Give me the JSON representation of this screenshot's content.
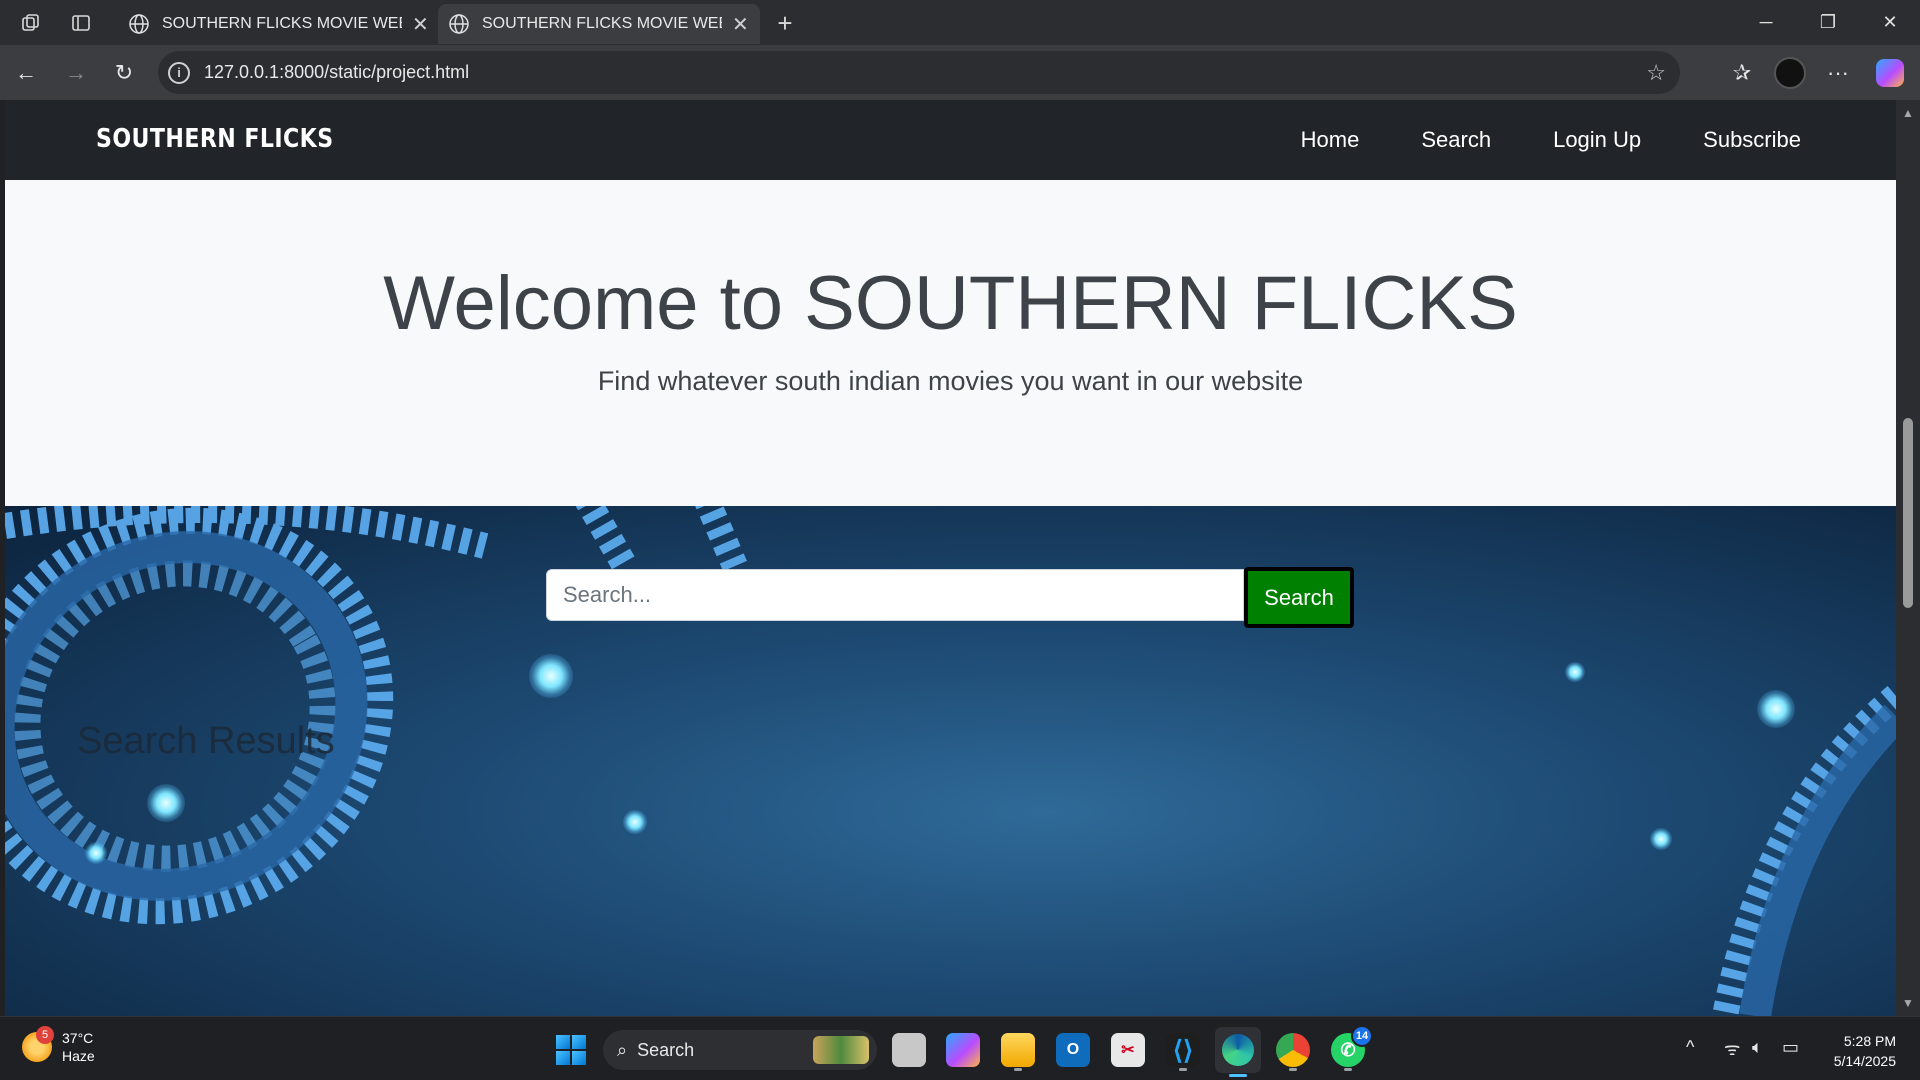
{
  "browser": {
    "tabs": [
      {
        "title": "SOUTHERN FLICKS MOVIE WEBSI",
        "active": false
      },
      {
        "title": "SOUTHERN FLICKS MOVIE WEBSI",
        "active": true
      }
    ],
    "new_tab_symbol": "+",
    "url": "127.0.0.1:8000/static/project.html"
  },
  "site": {
    "brand": "SOUTHERN FLICKS",
    "nav": [
      "Home",
      "Search",
      "Login Up",
      "Subscribe"
    ],
    "hero": {
      "title": "Welcome to SOUTHERN FLICKS",
      "subtitle": "Find whatever south indian movies you want in our website"
    },
    "search": {
      "placeholder": "Search...",
      "button_label": "Search"
    },
    "results_heading": "Search Results"
  },
  "taskbar": {
    "weather": {
      "temp": "37°C",
      "condition": "Haze",
      "badge": "5"
    },
    "search_label": "Search",
    "apps": [
      "task-view",
      "copilot",
      "file-explorer",
      "outlook",
      "snipping-tool",
      "vs-code",
      "edge",
      "chrome",
      "whatsapp"
    ],
    "whatsapp_badge": "14",
    "time": "5:28 PM",
    "date": "5/14/2025"
  },
  "colors": {
    "site_nav_bg": "#212529",
    "hero_bg": "#f8f9fa",
    "search_button_bg": "#008000",
    "lower_bg": "#1e4466"
  }
}
